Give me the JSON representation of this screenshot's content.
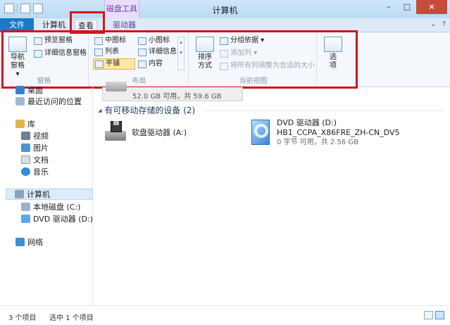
{
  "window": {
    "title": "计算机",
    "context_tab_group": "磁盘工具",
    "buttons": [
      "–",
      "□",
      "×"
    ]
  },
  "tabs": {
    "file": "文件",
    "computer": "计算机",
    "view": "查看",
    "drive": "驱动器",
    "right_glyphs": [
      "⌄",
      "?"
    ]
  },
  "ribbon": {
    "panes": {
      "label": "窗格",
      "nav_pane": "导航\n窗格",
      "nav_pane_arrow": "▾",
      "preview": "预览窗格",
      "details": "详细信息窗格"
    },
    "layout": {
      "label": "布局",
      "items": [
        "中图标",
        "小图标",
        "列表",
        "详细信息",
        "平铺",
        "内容"
      ],
      "selected": "平铺"
    },
    "current_view": {
      "label": "当前视图",
      "sort": "排序\n方式",
      "sort_arrow": "▾",
      "group_by": "分组依据 ▾",
      "add_column": "添加列 ▾",
      "fit_columns": "将所有列调整为合适的大小"
    },
    "options": {
      "label": "选\n项",
      "arrow": "▾"
    }
  },
  "sidebar": {
    "items": [
      {
        "label": "桌面",
        "icon": "desktop-icon"
      },
      {
        "label": "最近访问的位置",
        "icon": "recent-places-icon"
      },
      {
        "label": "库",
        "icon": "libraries-icon"
      },
      {
        "label": "视频",
        "icon": "videos-icon"
      },
      {
        "label": "图片",
        "icon": "pictures-icon"
      },
      {
        "label": "文档",
        "icon": "documents-icon"
      },
      {
        "label": "音乐",
        "icon": "music-icon"
      },
      {
        "label": "计算机",
        "icon": "computer-icon"
      },
      {
        "label": "本地磁盘 (C:)",
        "icon": "local-disk-icon"
      },
      {
        "label": "DVD 驱动器 (D:) HI",
        "icon": "dvd-drive-icon"
      },
      {
        "label": "网络",
        "icon": "network-icon"
      }
    ]
  },
  "content": {
    "local_disk_info": "52.0 GB 可用，共 59.6 GB",
    "section_title": "有可移动存储的设备 (2)",
    "section_toggle": "◢",
    "devices": [
      {
        "name": "软盘驱动器 (A:)",
        "line2": "",
        "line3": ""
      },
      {
        "name": "DVD 驱动器 (D:)",
        "line2": "HB1_CCPA_X86FRE_ZH-CN_DV5",
        "line3": "0 字节 可用，共 2.56 GB"
      }
    ]
  },
  "status": {
    "count": "3 个项目",
    "selected": "选中 1 个项目"
  },
  "colors": {
    "file_tab": "#1979ca",
    "highlight": "#d0161e",
    "selected_layout": "#ffe8a6"
  }
}
